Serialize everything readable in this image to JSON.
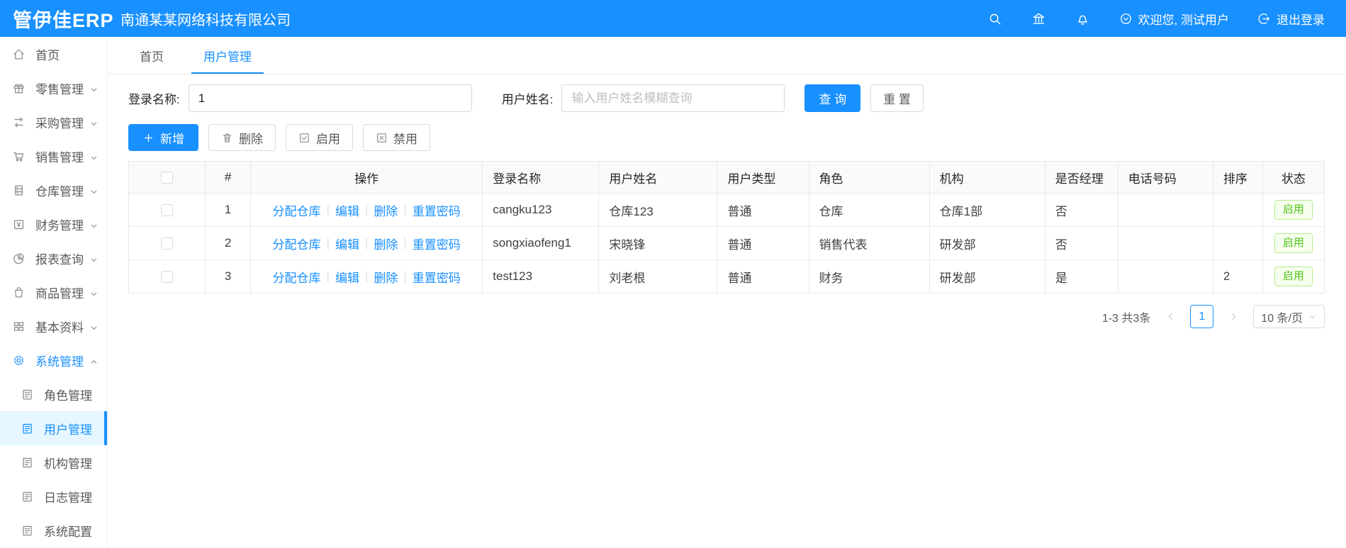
{
  "header": {
    "logo": "管伊佳ERP",
    "company": "南通某某网络科技有限公司",
    "welcome": "欢迎您, 测试用户",
    "logout": "退出登录"
  },
  "sidebar": {
    "items": [
      {
        "label": "首页",
        "icon": "home-icon"
      },
      {
        "label": "零售管理",
        "icon": "retail-icon"
      },
      {
        "label": "采购管理",
        "icon": "purchase-icon"
      },
      {
        "label": "销售管理",
        "icon": "sales-icon"
      },
      {
        "label": "仓库管理",
        "icon": "warehouse-icon"
      },
      {
        "label": "财务管理",
        "icon": "finance-icon"
      },
      {
        "label": "报表查询",
        "icon": "report-icon"
      },
      {
        "label": "商品管理",
        "icon": "goods-icon"
      },
      {
        "label": "基本资料",
        "icon": "basic-data-icon"
      },
      {
        "label": "系统管理",
        "icon": "gear-icon",
        "state": "expanded-active"
      },
      {
        "label": "角色管理",
        "icon": "doc-icon",
        "sub": true
      },
      {
        "label": "用户管理",
        "icon": "doc-icon",
        "sub": true,
        "state": "selected"
      },
      {
        "label": "机构管理",
        "icon": "doc-icon",
        "sub": true
      },
      {
        "label": "日志管理",
        "icon": "doc-icon",
        "sub": true
      },
      {
        "label": "系统配置",
        "icon": "doc-icon",
        "sub": true
      }
    ]
  },
  "tabs": [
    {
      "label": "首页",
      "active": false
    },
    {
      "label": "用户管理",
      "active": true
    }
  ],
  "search": {
    "login_label": "登录名称:",
    "login_value": "1",
    "name_label": "用户姓名:",
    "name_placeholder": "输入用户姓名模糊查询",
    "query_button": "查 询",
    "reset_button": "重 置"
  },
  "toolbar": {
    "add": "新增",
    "delete": "删除",
    "enable": "启用",
    "disable": "禁用"
  },
  "table": {
    "columns": [
      "#",
      "操作",
      "登录名称",
      "用户姓名",
      "用户类型",
      "角色",
      "机构",
      "是否经理",
      "电话号码",
      "排序",
      "状态"
    ],
    "action_links": [
      "分配仓库",
      "编辑",
      "删除",
      "重置密码"
    ],
    "rows": [
      {
        "index": "1",
        "login_name": "cangku123",
        "user_name": "仓库123",
        "user_type": "普通",
        "role": "仓库",
        "org": "仓库1部",
        "is_manager": "否",
        "phone": "",
        "sort": "",
        "status": "启用"
      },
      {
        "index": "2",
        "login_name": "songxiaofeng1",
        "user_name": "宋晓锋",
        "user_type": "普通",
        "role": "销售代表",
        "org": "研发部",
        "is_manager": "否",
        "phone": "",
        "sort": "",
        "status": "启用"
      },
      {
        "index": "3",
        "login_name": "test123",
        "user_name": "刘老根",
        "user_type": "普通",
        "role": "财务",
        "org": "研发部",
        "is_manager": "是",
        "phone": "",
        "sort": "2",
        "status": "启用"
      }
    ]
  },
  "pagination": {
    "total": "1-3 共3条",
    "current_page": "1",
    "page_size": "10 条/页"
  },
  "colors": {
    "primary": "#1890ff",
    "success": "#52c41a",
    "success_bg": "#f6ffed",
    "success_border": "#b7eb8f",
    "sidebar_selected_bg": "#e6f7ff",
    "table_border": "#e8e8e8"
  }
}
